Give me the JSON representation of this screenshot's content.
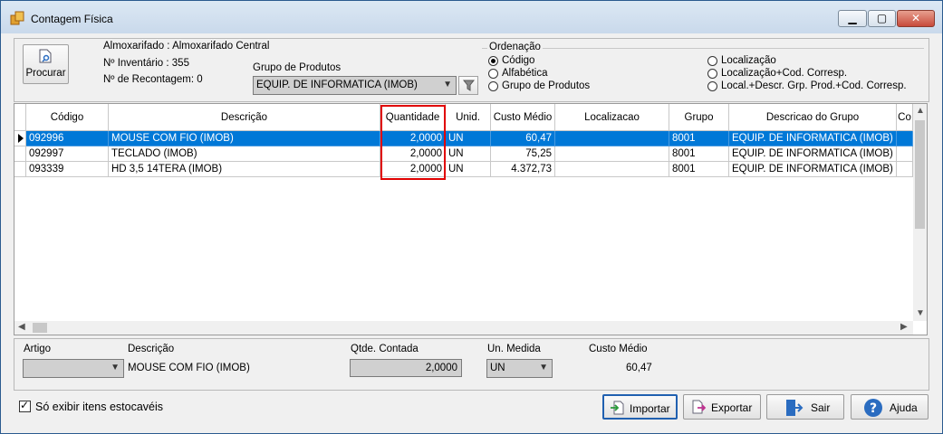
{
  "window": {
    "title": "Contagem Física",
    "min_glyph": "▁",
    "max_glyph": "▢",
    "close_glyph": "✕"
  },
  "toolbar": {
    "search_label": "Procurar",
    "almoxarifado": "Almoxarifado : Almoxarifado Central",
    "inventario": "Nº Inventário : 355",
    "recontagem": "Nº de Recontagem: 0",
    "grupo_label": "Grupo de Produtos",
    "grupo_value": "EQUIP. DE INFORMATICA (IMOB)"
  },
  "ordenacao": {
    "label": "Ordenação",
    "options": [
      {
        "label": "Código",
        "selected": true
      },
      {
        "label": "Alfabética",
        "selected": false
      },
      {
        "label": "Grupo de Produtos",
        "selected": false
      },
      {
        "label": "Localização",
        "selected": false
      },
      {
        "label": "Localização+Cod. Corresp.",
        "selected": false
      },
      {
        "label": "Local.+Descr. Grp. Prod.+Cod. Corresp.",
        "selected": false
      }
    ]
  },
  "grid": {
    "columns": [
      "Código",
      "Descrição",
      "Quantidade",
      "Unid.",
      "Custo Médio",
      "Localizacao",
      "Grupo",
      "Descricao do Grupo",
      "Co"
    ],
    "rows": [
      [
        "092996",
        "MOUSE COM FIO (IMOB)",
        "2,0000",
        "UN",
        "60,47",
        "",
        "8001",
        "EQUIP. DE INFORMATICA (IMOB)",
        ""
      ],
      [
        "092997",
        "TECLADO (IMOB)",
        "2,0000",
        "UN",
        "75,25",
        "",
        "8001",
        "EQUIP. DE INFORMATICA (IMOB)",
        ""
      ],
      [
        "093339",
        "HD 3,5 14TERA (IMOB)",
        "2,0000",
        "UN",
        "4.372,73",
        "",
        "8001",
        "EQUIP. DE INFORMATICA (IMOB)",
        ""
      ]
    ],
    "selected_row": 0
  },
  "detail": {
    "artigo_label": "Artigo",
    "artigo_value": "",
    "descricao_label": "Descrição",
    "descricao_value": "MOUSE COM FIO (IMOB)",
    "qtde_label": "Qtde. Contada",
    "qtde_value": "2,0000",
    "unidade_label": "Un. Medida",
    "unidade_value": "UN",
    "custo_label": "Custo Médio",
    "custo_value": "60,47"
  },
  "footer": {
    "checkbox_label": "Só exibir itens estocavéis",
    "importar": "Importar",
    "exportar": "Exportar",
    "sair": "Sair",
    "ajuda": "Ajuda"
  },
  "colors": {
    "selection": "#0078d7",
    "highlight": "#e00000"
  }
}
